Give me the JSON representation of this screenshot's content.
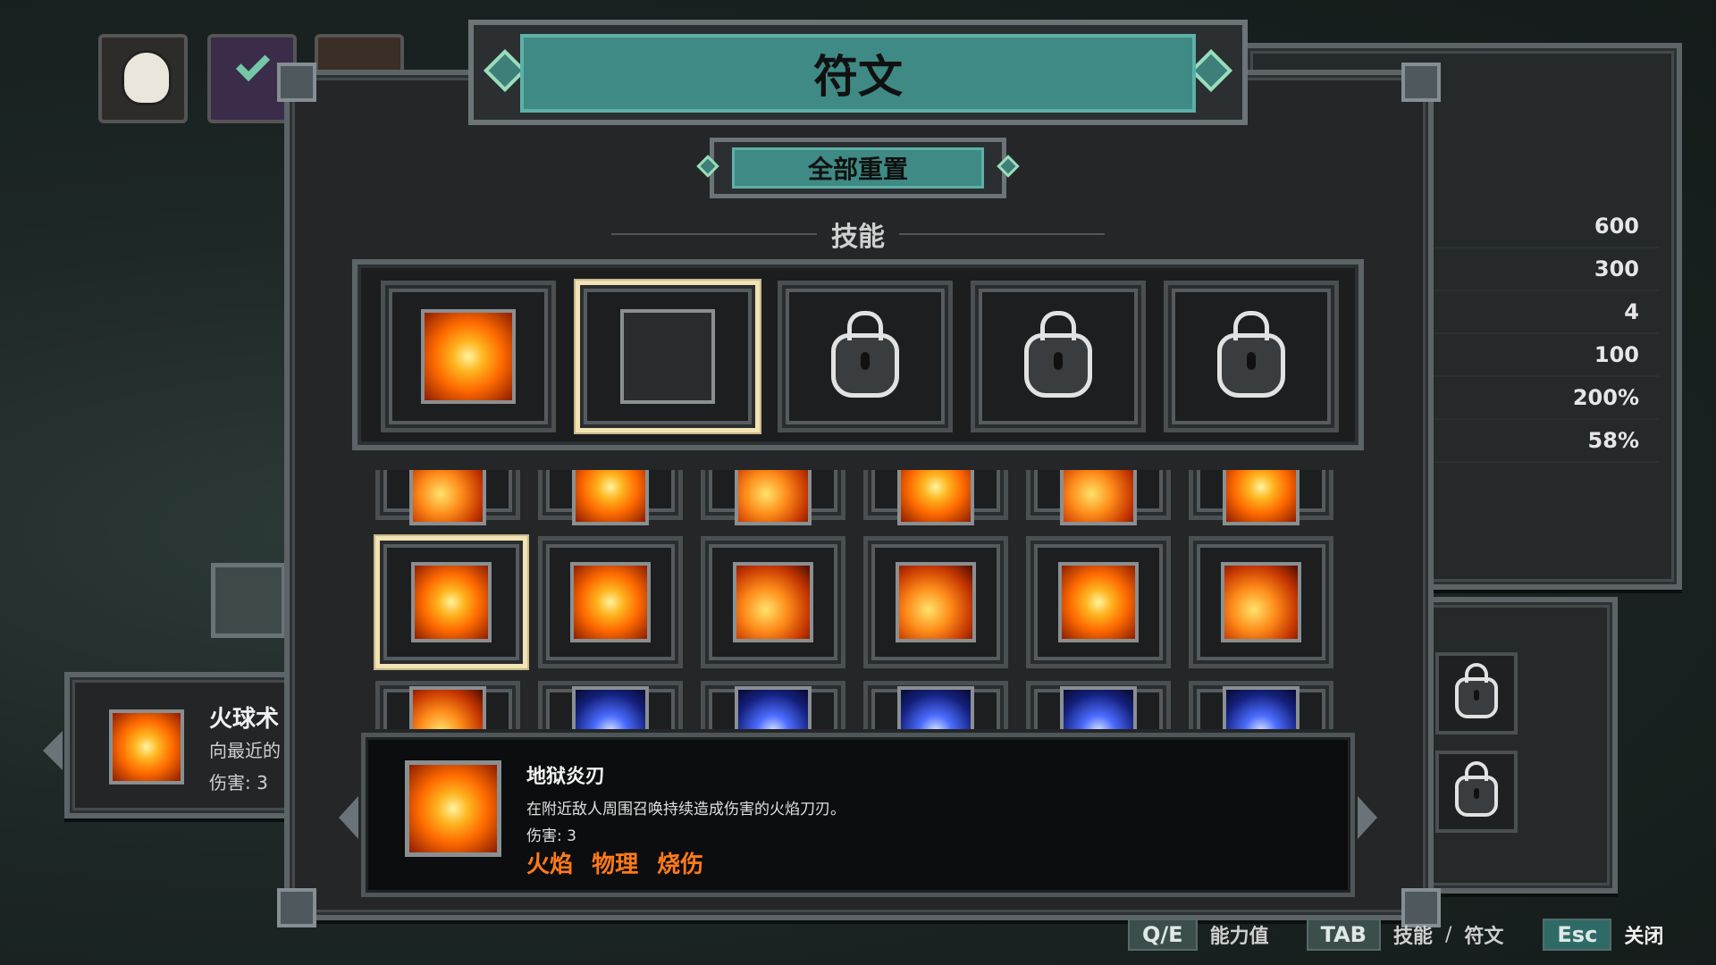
{
  "title": "符文",
  "reset_button": "全部重置",
  "section_label": "技能",
  "equipped_slots": [
    {
      "state": "filled",
      "icon": "fire-slash-icon"
    },
    {
      "state": "empty",
      "selected": true
    },
    {
      "state": "locked"
    },
    {
      "state": "locked"
    },
    {
      "state": "locked"
    }
  ],
  "rune_grid": {
    "row_top_partial": [
      "fire-swirl-icon",
      "fire-egg-icon",
      "fire-spark-icon",
      "fire-burst-icon",
      "fire-dragon-icon",
      "fire-wave-icon"
    ],
    "row_main": [
      "hell-flame-blade-icon",
      "fire-explosion-icon",
      "meteor-icon",
      "bonfire-icon",
      "fire-pentagram-icon",
      "fire-spear-icon"
    ],
    "row_bottom_partial": [
      "lightning-1-icon",
      "lightning-2-icon",
      "lightning-3-icon",
      "lightning-4-icon",
      "lightning-5-icon",
      "lightning-6-icon"
    ],
    "selected_index": 0
  },
  "detail": {
    "name": "地狱炎刃",
    "description": "在附近敌人周围召唤持续造成伤害的火焰刀刃。",
    "damage": "伤害: 3",
    "tags": [
      "火焰",
      "物理",
      "烧伤"
    ]
  },
  "stats": [
    "600",
    "300",
    "4",
    "100",
    "200%",
    "58%"
  ],
  "left_skill": {
    "name": "火球术",
    "desc": "向最近的",
    "damage": "伤害: 3"
  },
  "footer": {
    "qe_key": "Q/E",
    "qe_label": "能力值",
    "tab_key": "TAB",
    "tab_label_1": "技能",
    "tab_sep": "/",
    "tab_label_2": "符文",
    "esc_key": "Esc",
    "esc_label": "关闭"
  },
  "colors": {
    "accent_teal": "#3f8a84",
    "tag_orange": "#ff7a1a",
    "selected_border": "#f1e3b4"
  }
}
